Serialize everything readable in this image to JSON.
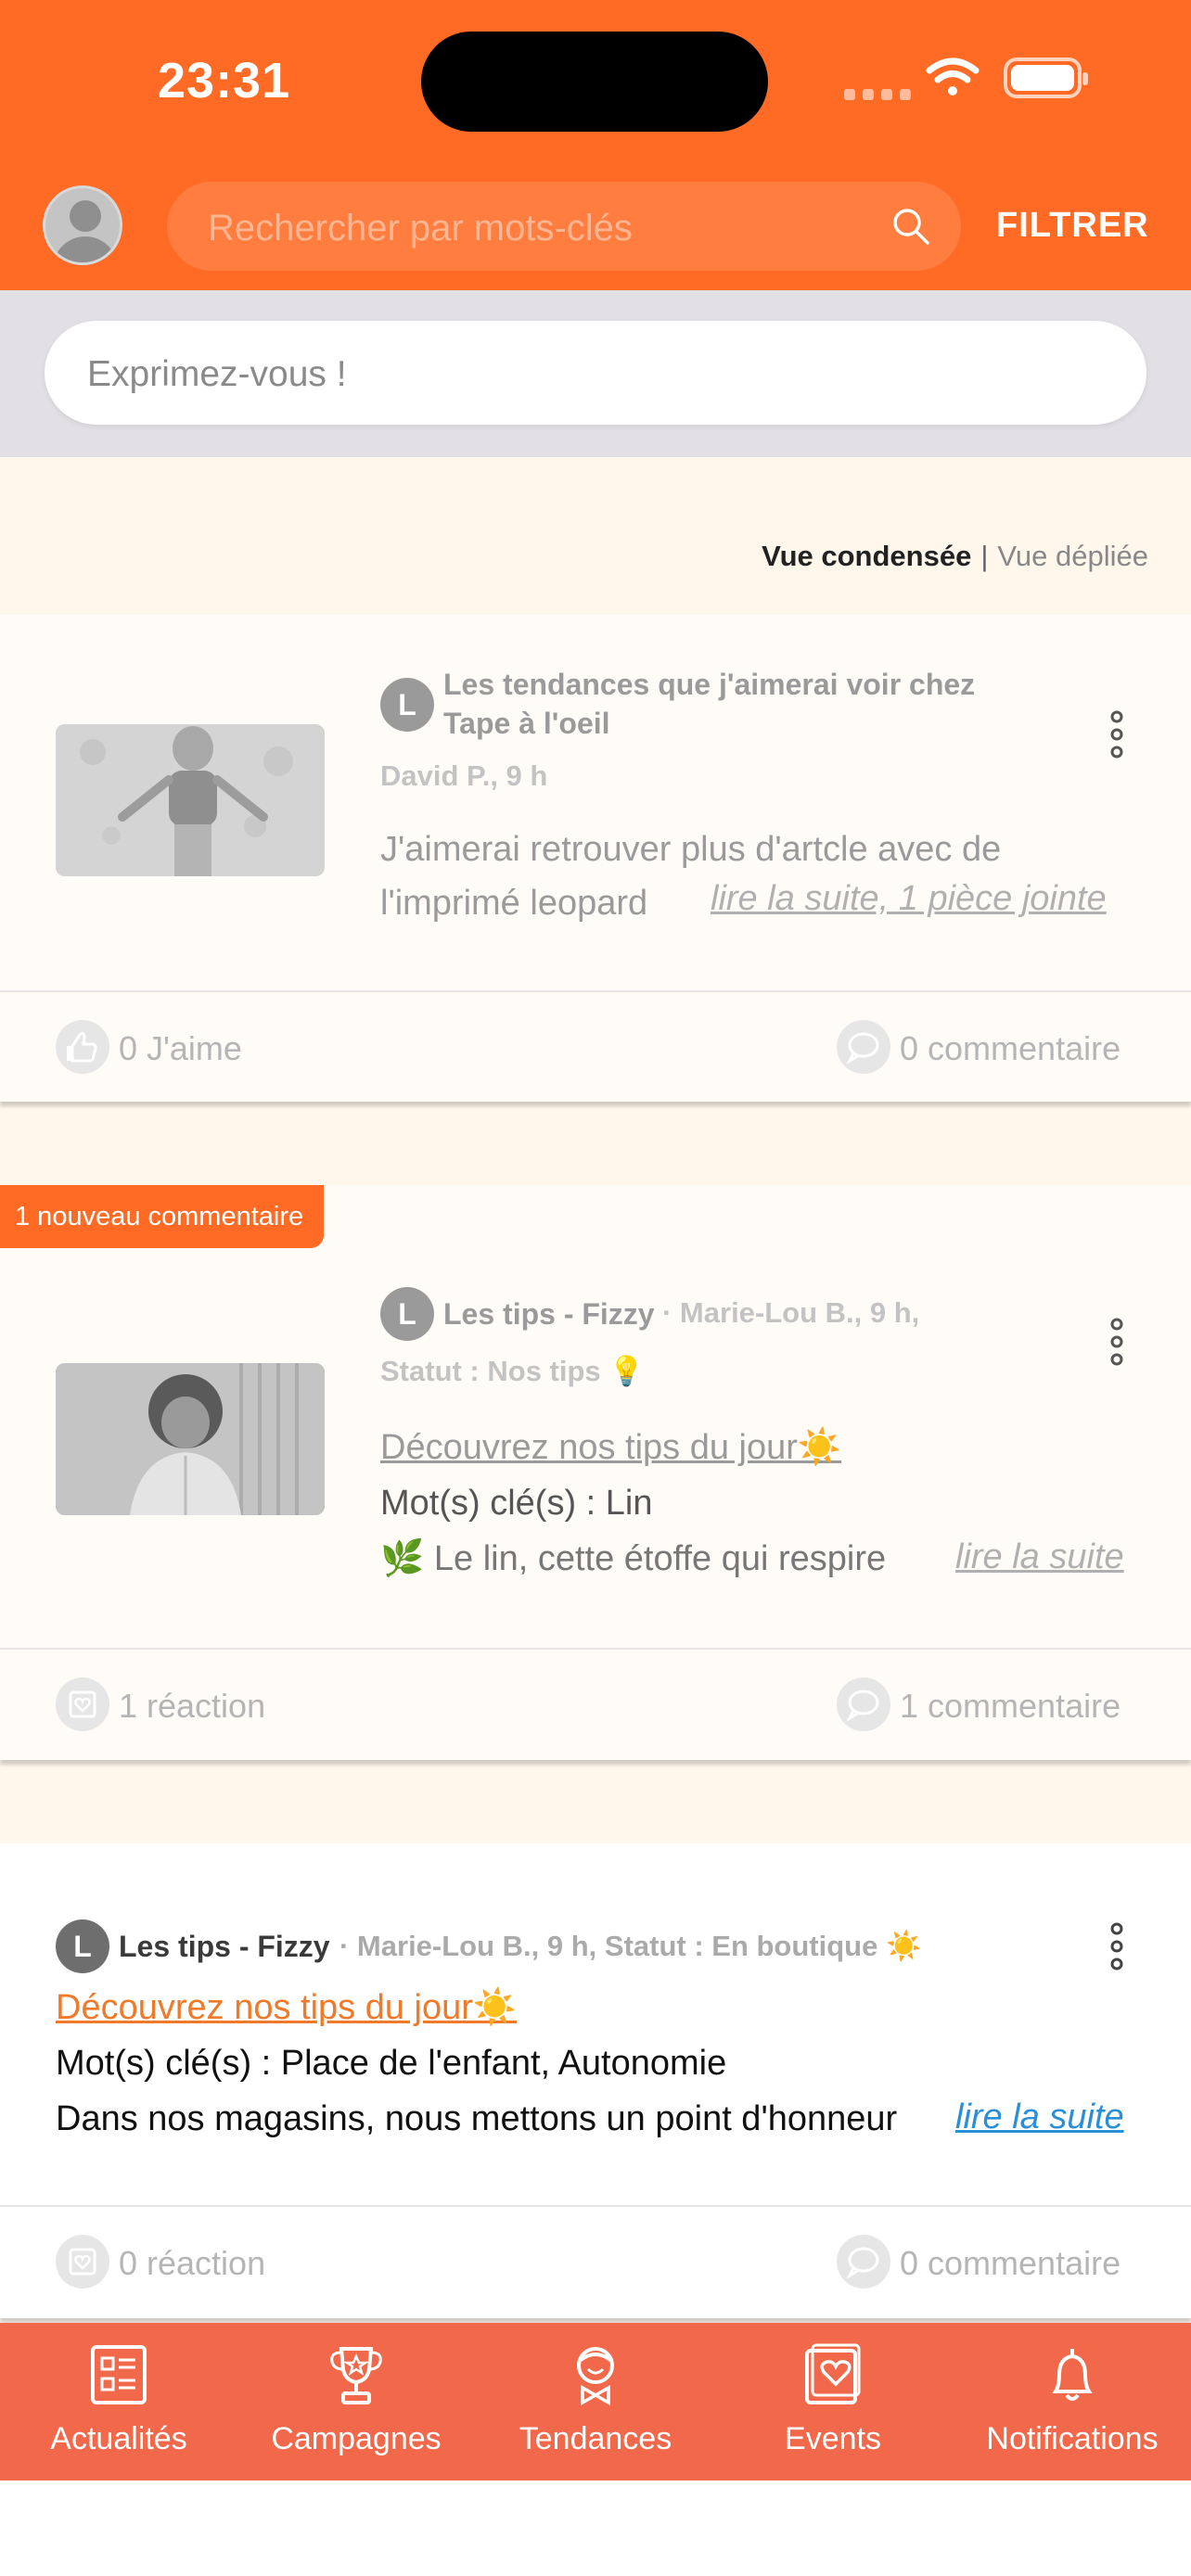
{
  "status_bar": {
    "time": "23:31"
  },
  "header": {
    "search_placeholder": "Rechercher par mots-clés",
    "filter_label": "FILTRER"
  },
  "composer": {
    "placeholder": "Exprimez-vous !"
  },
  "view_toggle": {
    "condensed": "Vue condensée",
    "separator": "|",
    "expanded": "Vue dépliée"
  },
  "posts": [
    {
      "avatar_letter": "L",
      "title_line1": "Les tendances que j'aimerai voir chez",
      "title_line2": "Tape à l'oeil",
      "meta": "David P., 9 h",
      "body_line1": "J'aimerai retrouver plus d'artcle avec de",
      "body_line2": "l'imprimé leopard",
      "read_more": "lire la suite, 1 pièce jointe",
      "reaction": "0 J'aime",
      "comments": "0 commentaire"
    },
    {
      "new_badge": "1 nouveau commentaire",
      "avatar_letter": "L",
      "title": "Les tips - Fizzy",
      "meta_line1": "· Marie-Lou B., 9 h,",
      "meta_line2": "Statut : Nos tips 💡",
      "link": "Découvrez nos tips du jour☀️",
      "keywords": "Mot(s) clé(s) :  Lin",
      "body_line": "🌿 Le lin, cette étoffe qui respire",
      "read_more": "lire la suite",
      "reaction": "1 réaction",
      "comments": "1 commentaire"
    },
    {
      "avatar_letter": "L",
      "title": "Les tips - Fizzy",
      "meta": "· Marie-Lou B., 9 h, Statut : En boutique ☀️",
      "link": "Découvrez nos tips du jour☀️",
      "keywords": "Mot(s) clé(s) :  Place de l'enfant, Autonomie",
      "body_line": "Dans nos magasins, nous mettons un point d'honneur",
      "read_more": "lire la suite",
      "reaction": "0 réaction",
      "comments": "0 commentaire"
    }
  ],
  "nav": [
    {
      "label": "Actualités",
      "icon": "news-icon"
    },
    {
      "label": "Campagnes",
      "icon": "trophy-icon"
    },
    {
      "label": "Tendances",
      "icon": "face-icon"
    },
    {
      "label": "Events",
      "icon": "heart-calendar-icon"
    },
    {
      "label": "Notifications",
      "icon": "bell-icon"
    }
  ],
  "colors": {
    "brand": "#ff6a25",
    "nav": "#f2684a",
    "link_orange": "#f07a2a",
    "link_blue": "#2a8fd4"
  }
}
